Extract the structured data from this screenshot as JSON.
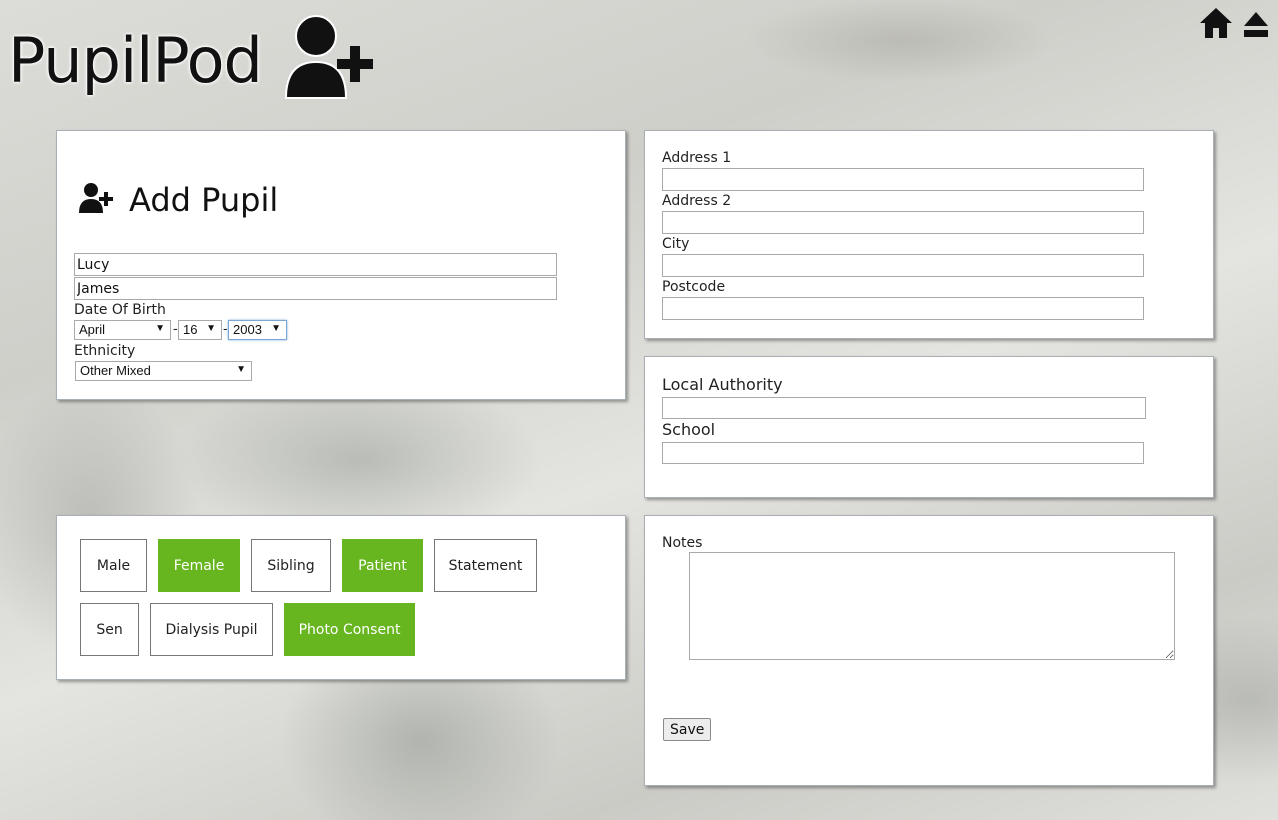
{
  "app": {
    "logo_text": "PupilPod"
  },
  "header_icons": [
    "home-icon",
    "eject-icon"
  ],
  "pupil": {
    "title": "Add Pupil",
    "first_name": "Lucy",
    "last_name": "James",
    "dob_label": "Date Of Birth",
    "dob_month": "April",
    "dob_day": "16",
    "dob_year": "2003",
    "dob_sep": "-",
    "ethnicity_label": "Ethnicity",
    "ethnicity": "Other Mixed"
  },
  "address": {
    "address1_label": "Address 1",
    "address2_label": "Address 2",
    "city_label": "City",
    "postcode_label": "Postcode",
    "address1": "",
    "address2": "",
    "city": "",
    "postcode": ""
  },
  "school": {
    "authority_label": "Local Authority",
    "school_label": "School",
    "authority": "",
    "school": ""
  },
  "tags": [
    {
      "label": "Male",
      "active": false
    },
    {
      "label": "Female",
      "active": true
    },
    {
      "label": "Sibling",
      "active": false
    },
    {
      "label": "Patient",
      "active": true
    },
    {
      "label": "Statement",
      "active": false
    },
    {
      "label": "Sen",
      "active": false
    },
    {
      "label": "Dialysis Pupil",
      "active": false
    },
    {
      "label": "Photo Consent",
      "active": true
    }
  ],
  "notes": {
    "label": "Notes",
    "value": "",
    "save_label": "Save"
  },
  "colors": {
    "active_tag": "#67b51f",
    "panel_border": "#a9b0b5"
  }
}
